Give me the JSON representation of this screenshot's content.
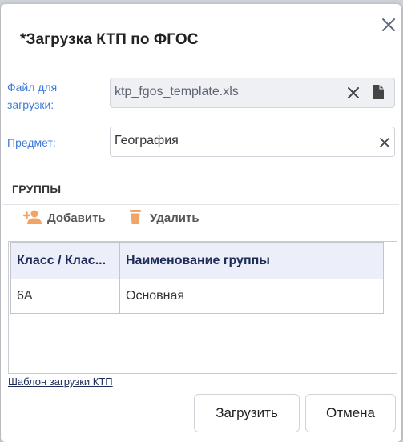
{
  "dialog": {
    "title": "*Загрузка КТП по ФГОС",
    "close_icon": "close-icon"
  },
  "file_field": {
    "label_line1": "Файл для",
    "label_line2": "загрузки:",
    "value": "ktp_fgos_template.xls",
    "clear_icon": "clear-icon",
    "file_icon": "file-icon"
  },
  "subject_field": {
    "label": "Предмет:",
    "value": "География",
    "clear_icon": "clear-icon"
  },
  "groups": {
    "title": "ГРУППЫ",
    "toolbar": {
      "add_label": "Добавить",
      "delete_label": "Удалить",
      "add_icon": "add-user-icon",
      "delete_icon": "trash-icon"
    },
    "columns": [
      "Класс / Клас...",
      "Наименование группы"
    ],
    "rows": [
      [
        "6А",
        "Основная"
      ]
    ]
  },
  "template_link": "Шаблон загрузки КТП",
  "footer": {
    "upload_label": "Загрузить",
    "cancel_label": "Отмена"
  },
  "colors": {
    "label_blue": "#3d7bd9",
    "header_bg": "#eceefa",
    "header_text": "#1d2b57",
    "icon_orange": "#f0a468"
  }
}
